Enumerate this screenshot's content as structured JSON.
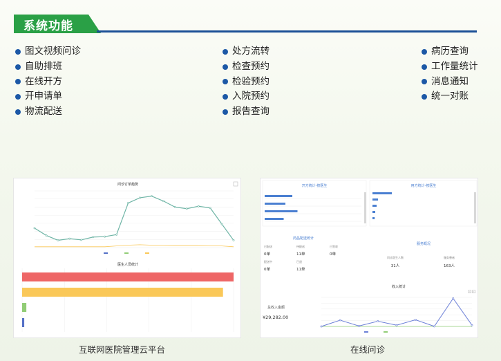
{
  "section": {
    "title": "系统功能",
    "accent_color": "#2aa046",
    "rule_color": "#1a4f96"
  },
  "features": {
    "col1": [
      "图文视频问诊",
      "自助排班",
      "在线开方",
      "开申请单",
      "物流配送"
    ],
    "col2": [
      "处方流转",
      "检查预约",
      "检验预约",
      "入院预约",
      "报告查询"
    ],
    "col3": [
      "病历查询",
      "工作量统计",
      "消息通知",
      "统一对账"
    ]
  },
  "panels": {
    "left": {
      "caption": "互联网医院管理云平台",
      "line_chart": {
        "type": "line",
        "title": "问诊订单趋势",
        "ylim": [
          0,
          1400
        ],
        "values": [
          480,
          300,
          180,
          220,
          190,
          260,
          270,
          320,
          1100,
          1230,
          1270,
          1150,
          1000,
          960,
          1020,
          980,
          580,
          180
        ],
        "values_flat": [
          20,
          20,
          20,
          20,
          20,
          20,
          20,
          40,
          60,
          70,
          60,
          55,
          50,
          50,
          50,
          45,
          40,
          20
        ]
      },
      "bar_chart": {
        "type": "bar",
        "title": "医生人员统计",
        "values": [
          100,
          95,
          2,
          1
        ],
        "colors": [
          "#ee6666",
          "#fac858",
          "#91cc75",
          "#5470c6"
        ]
      }
    },
    "right": {
      "caption": "在线问诊",
      "sub1_title": "开方统计-按医生",
      "sub2_title": "用方统计-按医生",
      "stats_title": "药品配送统计",
      "stats": [
        {
          "label": "已配送",
          "value": "0单"
        },
        {
          "label": "待配送",
          "value": "11单"
        },
        {
          "label": "已签收",
          "value": "0单"
        },
        {
          "label": "配送中",
          "value": "0单"
        },
        {
          "label": "已退",
          "value": "11单"
        }
      ],
      "service_title": "服务概况",
      "service": [
        {
          "label": "问诊医生人数",
          "value": "31人"
        },
        {
          "label": "服务患者",
          "value": "163人"
        }
      ],
      "income_title": "收入统计",
      "income_label": "总收入金额",
      "income_value": "¥29,282.00",
      "income_chart": {
        "type": "line",
        "values": [
          0,
          300,
          20,
          250,
          60,
          320,
          5,
          1350,
          60
        ],
        "values2": [
          0,
          0,
          0,
          0,
          0,
          0,
          0,
          0,
          0
        ]
      }
    }
  }
}
